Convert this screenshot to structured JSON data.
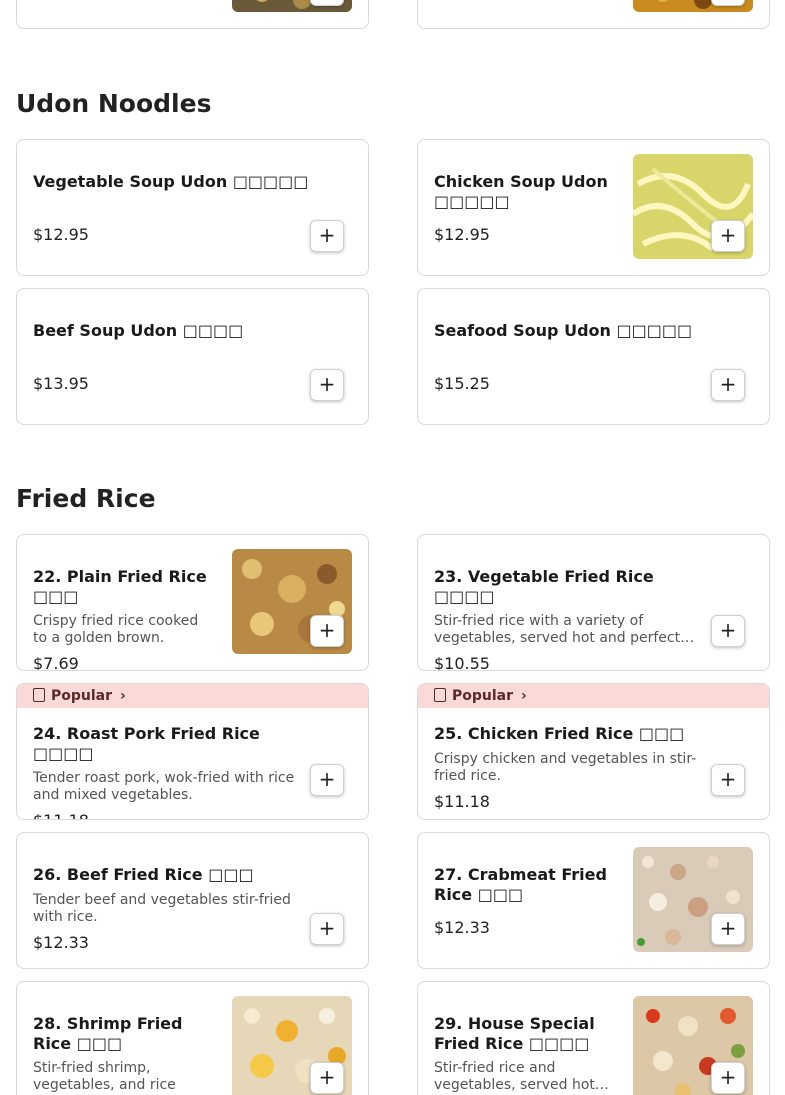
{
  "sections": {
    "udon": {
      "title": "Udon Noodles"
    },
    "fried_rice": {
      "title": "Fried Rice"
    }
  },
  "add_label": "+",
  "popular_label": "Popular",
  "top_partial": {
    "left": {},
    "right": {}
  },
  "udon_items": [
    {
      "name": "Vegetable Soup Udon",
      "cjk": "□□□□□",
      "price": "$12.95",
      "has_image": false
    },
    {
      "name": "Chicken Soup Udon",
      "cjk": "□□□□□",
      "price": "$12.95",
      "has_image": true
    },
    {
      "name": "Beef Soup Udon",
      "cjk": "□□□□",
      "price": "$13.95",
      "has_image": false
    },
    {
      "name": "Seafood Soup Udon",
      "cjk": "□□□□□",
      "price": "$15.25",
      "has_image": false
    }
  ],
  "rice_items": [
    {
      "name": "22. Plain Fried Rice",
      "cjk": "□□□",
      "desc": "Crispy fried rice cooked to a golden brown.",
      "price": "$7.69"
    },
    {
      "name": "23. Vegetable Fried Rice",
      "cjk": "□□□□",
      "desc": "Stir-fried rice with a variety of vegetables, served hot and perfect…",
      "price": "$10.55"
    },
    {
      "name": "24. Roast Pork Fried Rice",
      "cjk": "□□□□",
      "desc": "Tender roast pork, wok-fried with rice and mixed vegetables.",
      "price": "$11.18"
    },
    {
      "name": "25. Chicken Fried Rice",
      "cjk": "□□□",
      "desc": "Crispy chicken and vegetables in stir-fried rice.",
      "price": "$11.18"
    },
    {
      "name": "26. Beef Fried Rice",
      "cjk": "□□□",
      "desc": "Tender beef and vegetables stir-fried with rice.",
      "price": "$12.33"
    },
    {
      "name": "27. Crabmeat Fried Rice",
      "cjk": "□□□",
      "desc": "",
      "price": "$12.33"
    },
    {
      "name": "28. Shrimp Fried Rice",
      "cjk": "□□□",
      "desc": "Stir-fried shrimp, vegetables, and rice",
      "price": ""
    },
    {
      "name": "29. House Special Fried Rice",
      "cjk": "□□□□",
      "desc": "Stir-fried rice and vegetables, served hot…",
      "price": ""
    }
  ],
  "colors": {
    "popular_bg": "#fcd9d9",
    "border": "#d9d9d9"
  }
}
